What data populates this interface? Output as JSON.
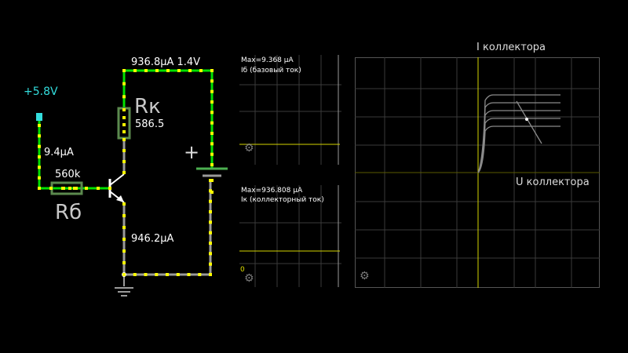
{
  "source": {
    "voltage_label": "+5.8V"
  },
  "wires": {
    "base_current": "9.4µA",
    "emitter_current": "946.2µA",
    "top_readout": "936.8µA 1.4V"
  },
  "resistors": {
    "rb": {
      "value": "560k",
      "name": "Rб"
    },
    "rk": {
      "value": "586.5",
      "name": "Rк"
    }
  },
  "battery": {
    "plus_sign": "+"
  },
  "scope_base": {
    "max_label": "Max=9.368 µA",
    "trace_label": "Iб (базовый ток)"
  },
  "scope_collector": {
    "max_label": "Max=936.808 µA",
    "trace_label": "Iк (коллекторный ток)",
    "zero_label": "0"
  },
  "plot": {
    "y_label": "I коллектора",
    "x_label": "U коллектора"
  },
  "colors": {
    "wire_live": "#00e000",
    "wire_gray": "#9a9a9a",
    "dot": "#ffff00",
    "source": "#33dddd",
    "resistor": "#5b8a4e",
    "trace": "#d4d400",
    "grid": "#3a3a3a"
  },
  "icons": {
    "gear": "⚙"
  }
}
